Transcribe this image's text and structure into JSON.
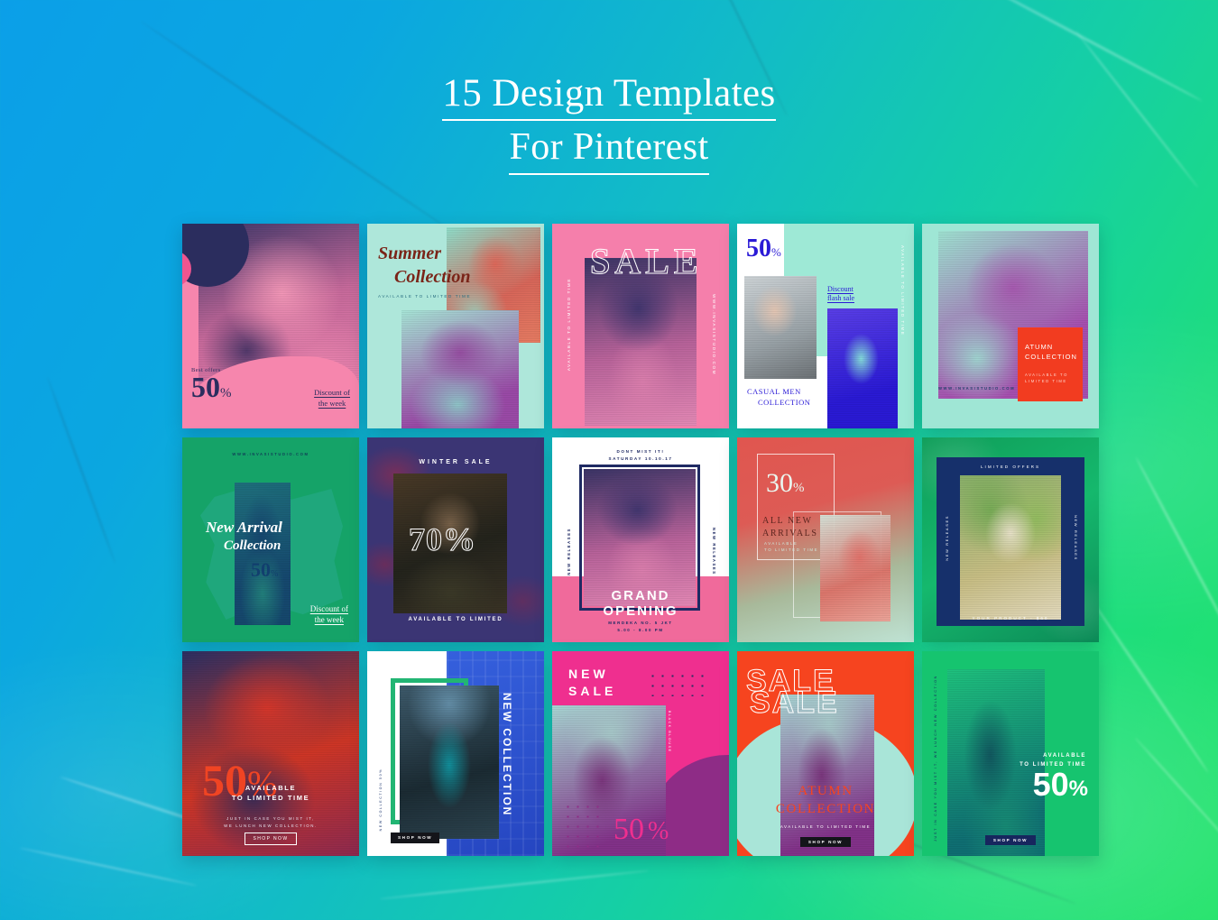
{
  "header": {
    "title_line1": "15 Design Templates",
    "title_line2": "For Pinterest"
  },
  "background": {
    "gradient_from": "#0b9fe8",
    "gradient_to": "#23e36a",
    "texture": "marble"
  },
  "templates": [
    {
      "id": 1,
      "name": "best-offers-50",
      "bg": "#f686ad",
      "accent": "#2b2d5e",
      "texts": {
        "eyebrow": "Best offers",
        "percent": "50",
        "percent_sign": "%",
        "cta": "Discount of\nthe week"
      }
    },
    {
      "id": 2,
      "name": "summer-collection",
      "bg": "#aee7da",
      "accent": "#6b1f1f",
      "texts": {
        "script_line1": "Summer",
        "script_line2": "Collection",
        "subtitle": "AVAILABLE TO LIMITED TIME"
      }
    },
    {
      "id": 3,
      "name": "sale-outline",
      "bg": "#f57fab",
      "accent": "#3a2c64",
      "texts": {
        "headline": "SALE",
        "left_vertical": "AVAILABLE TO LIMITED TIME",
        "right_vertical": "WWW.INVASISTUDIO.COM"
      }
    },
    {
      "id": 4,
      "name": "casual-men-collection",
      "bg": "#9ee9d6",
      "accent": "#2a1ad6",
      "texts": {
        "percent": "50",
        "percent_sign": "%",
        "discount_line1": "Discount",
        "discount_line2": "flash sale",
        "title_line1": "CASUAL MEN",
        "title_line2": "COLLECTION",
        "right_vertical": "AVAILABLE TO LIMITED TIME"
      }
    },
    {
      "id": 5,
      "name": "atumn-collection-mint",
      "bg": "#9fe6d5",
      "accent": "#f23c20",
      "texts": {
        "title_line1": "ATUMN",
        "title_line2": "COLLECTION",
        "subtitle_line1": "AVAILABLE TO",
        "subtitle_line2": "LIMITED TIME",
        "url": "WWW.INVASISTUDIO.COM"
      }
    },
    {
      "id": 6,
      "name": "new-arrival-collection",
      "bg": "#15a368",
      "accent": "#123f6e",
      "texts": {
        "url": "WWW.INVASISTUDIO.COM",
        "script_line1": "New Arrival",
        "script_line2": "Collection",
        "percent": "50",
        "percent_sign": "%",
        "cta_line1": "Discount of",
        "cta_line2": "the week"
      }
    },
    {
      "id": 7,
      "name": "winter-sale-70",
      "bg": "#3b3574",
      "accent": "#ffffff",
      "texts": {
        "eyebrow": "WINTER SALE",
        "percent": "70%",
        "footer": "AVAILABLE TO LIMITED"
      }
    },
    {
      "id": 8,
      "name": "grand-opening",
      "bg": "#ffffff",
      "accent": "#f06a9b",
      "texts": {
        "top_line1": "DONT MIST IT!",
        "top_line2": "SATURDAY 10.10.17",
        "left_vertical": "NEW RELEASES",
        "right_vertical": "NEW RELEASES",
        "title_line1": "GRAND",
        "title_line2": "OPENING",
        "address_line1": "MERDEKA NO. 5 JKT",
        "address_line2": "5.00 - 8.00 PM"
      }
    },
    {
      "id": 9,
      "name": "all-new-arrivals-30",
      "bg": "#e0564f",
      "accent": "#b9e8db",
      "texts": {
        "percent": "30",
        "percent_sign": "%",
        "title_line1": "ALL NEW",
        "title_line2": "ARRIVALS",
        "subtitle_line1": "AVAILABLE",
        "subtitle_line2": "TO LIMITED TIME"
      }
    },
    {
      "id": 10,
      "name": "limited-offers-product",
      "bg": "#15a85f",
      "accent": "#16306b",
      "texts": {
        "top": "LIMITED OFFERS",
        "left_vertical": "NEW RELEASES",
        "right_vertical": "NEW RELEASES",
        "bottom": "YOUR PRODUCT - $60"
      }
    },
    {
      "id": 11,
      "name": "red-duotone-50",
      "bg": "#2a2f63",
      "accent": "#f04423",
      "texts": {
        "percent": "50",
        "percent_sign": "%",
        "overlay_line1": "AVAILABLE",
        "overlay_line2": "TO LIMITED TIME",
        "footer_line1": "JUST IN CASE YOU MIST IT,",
        "footer_line2": "WE LUNCH NEW COLLECTION.",
        "button": "SHOP NOW"
      }
    },
    {
      "id": 12,
      "name": "new-collection-blue",
      "bg": "#2e55d4",
      "accent": "#22b573",
      "texts": {
        "vertical_title": "NEW COLLECTION",
        "side_vertical_line1": "NEW COLLECTION",
        "side_vertical_line2": "50%",
        "button": "SHOP NOW"
      }
    },
    {
      "id": 13,
      "name": "new-sale-pink",
      "bg": "#ef2f8f",
      "accent": "#a5d7d4",
      "texts": {
        "title_line1": "NEW",
        "title_line2": "SALE",
        "percent": "50",
        "percent_sign": "%",
        "vertical": "BLACK BLOUSE"
      }
    },
    {
      "id": 14,
      "name": "atumn-collection-sale",
      "bg": "#f6441f",
      "accent": "#a9e5d8",
      "texts": {
        "outline_sale_1": "SALE",
        "outline_sale_2": "SALE",
        "title_line1": "ATUMN",
        "title_line2": "COLLECTION",
        "subtitle": "AVAILABLE TO LIMITED TIME",
        "button": "SHOP NOW"
      }
    },
    {
      "id": 15,
      "name": "green-duotone-50",
      "bg": "#16c46f",
      "accent": "#17265e",
      "texts": {
        "vertical_line1": "JUST IN CASE YOU MIST IT,",
        "vertical_line2": "WE LUNCH NEW COLLECTION",
        "subtitle_line1": "AVAILABLE",
        "subtitle_line2": "TO LIMITED TIME",
        "percent": "50",
        "percent_sign": "%",
        "button": "SHOP NOW"
      }
    }
  ]
}
